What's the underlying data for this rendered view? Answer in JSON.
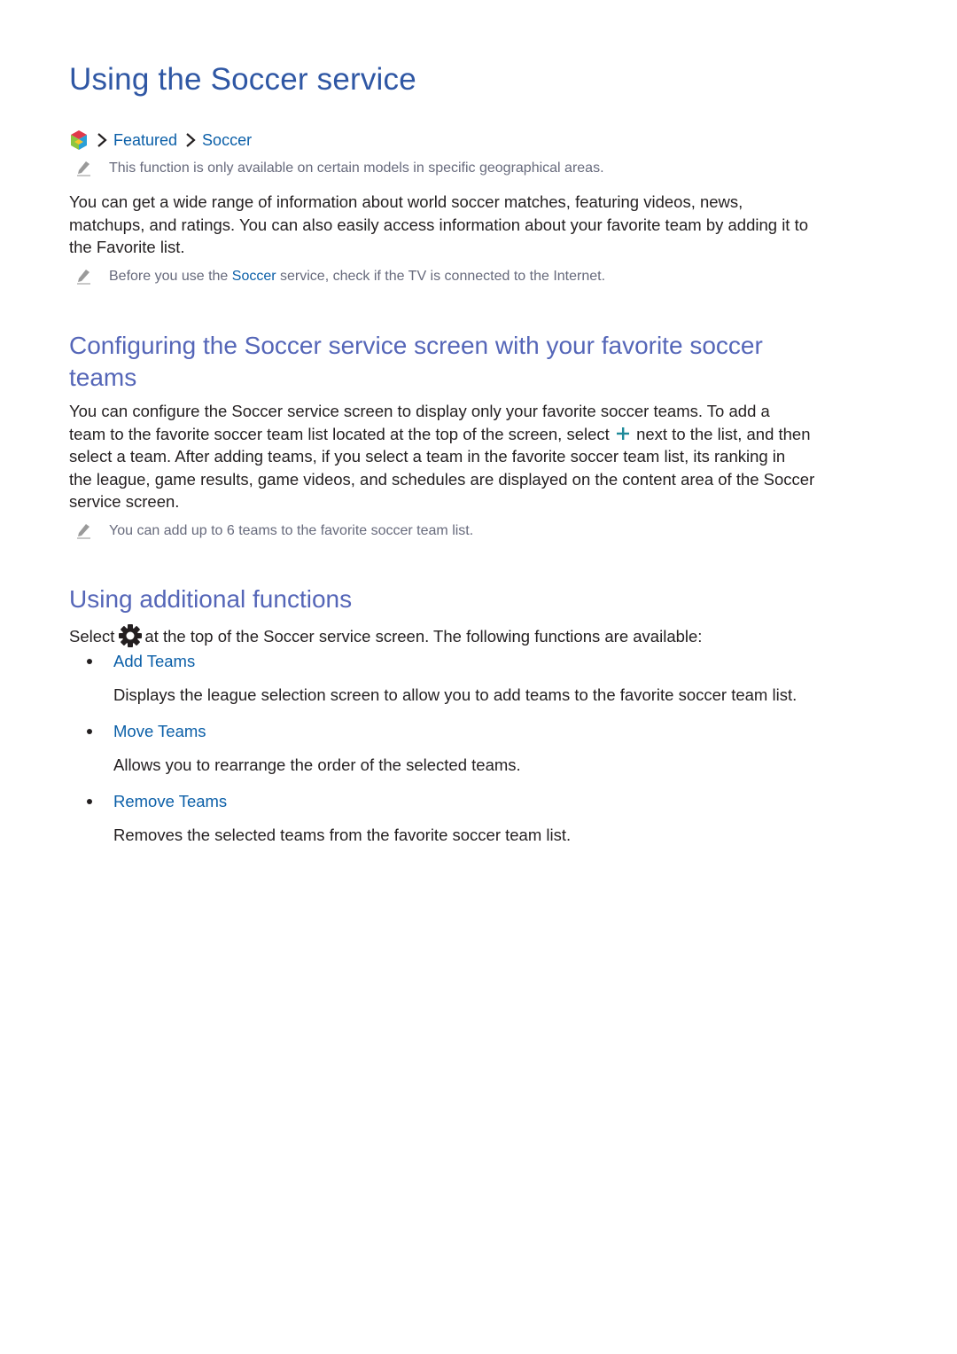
{
  "title": "Using the Soccer service",
  "breadcrumb": {
    "home_icon": "smart-hub-icon",
    "items": [
      "Featured",
      "Soccer"
    ]
  },
  "notes": {
    "availability": "This function is only available on certain models in specific geographical areas.",
    "internet_before": "Before you use the ",
    "internet_link": "Soccer",
    "internet_after": " service, check if the TV is connected to the Internet.",
    "max_teams": "You can add up to 6 teams to the favorite soccer team list."
  },
  "intro": {
    "lines": [
      "You can get a wide range of information about world soccer matches, featuring videos, news,",
      "matchups, and ratings. You can also easily access information about your favorite team by adding it to",
      "the Favorite list."
    ]
  },
  "section_configure": {
    "heading_line1": "Configuring the Soccer service screen with your favorite soccer",
    "heading_line2": "teams",
    "line1": "You can configure the Soccer service screen to display only your favorite soccer teams. To add a",
    "line2_before": "team to the favorite soccer team list located at the top of the screen, select",
    "line2_after": "next to the list, and then",
    "line3": "select a team. After adding teams, if you select a team in the favorite soccer team list, its ranking in",
    "line4": "the league, game results, game videos, and schedules are displayed on the content area of the Soccer",
    "line5": "service screen."
  },
  "section_additional": {
    "heading": "Using additional functions",
    "intro_before": "Select",
    "intro_after": "at the top of the Soccer service screen. The following functions are available:",
    "items": [
      {
        "label": "Add Teams",
        "description": "Displays the league selection screen to allow you to add teams to the favorite soccer team list."
      },
      {
        "label": "Move Teams",
        "description": "Allows you to rearrange the order of the selected teams."
      },
      {
        "label": "Remove Teams",
        "description": "Removes the selected teams from the favorite soccer team list."
      }
    ]
  },
  "colors": {
    "title": "#2f57a4",
    "subheading": "#5566b8",
    "link": "#0b5fa8",
    "note_text": "#676a7c",
    "body_text": "#231f20",
    "plus_icon": "#1f8a9a"
  }
}
